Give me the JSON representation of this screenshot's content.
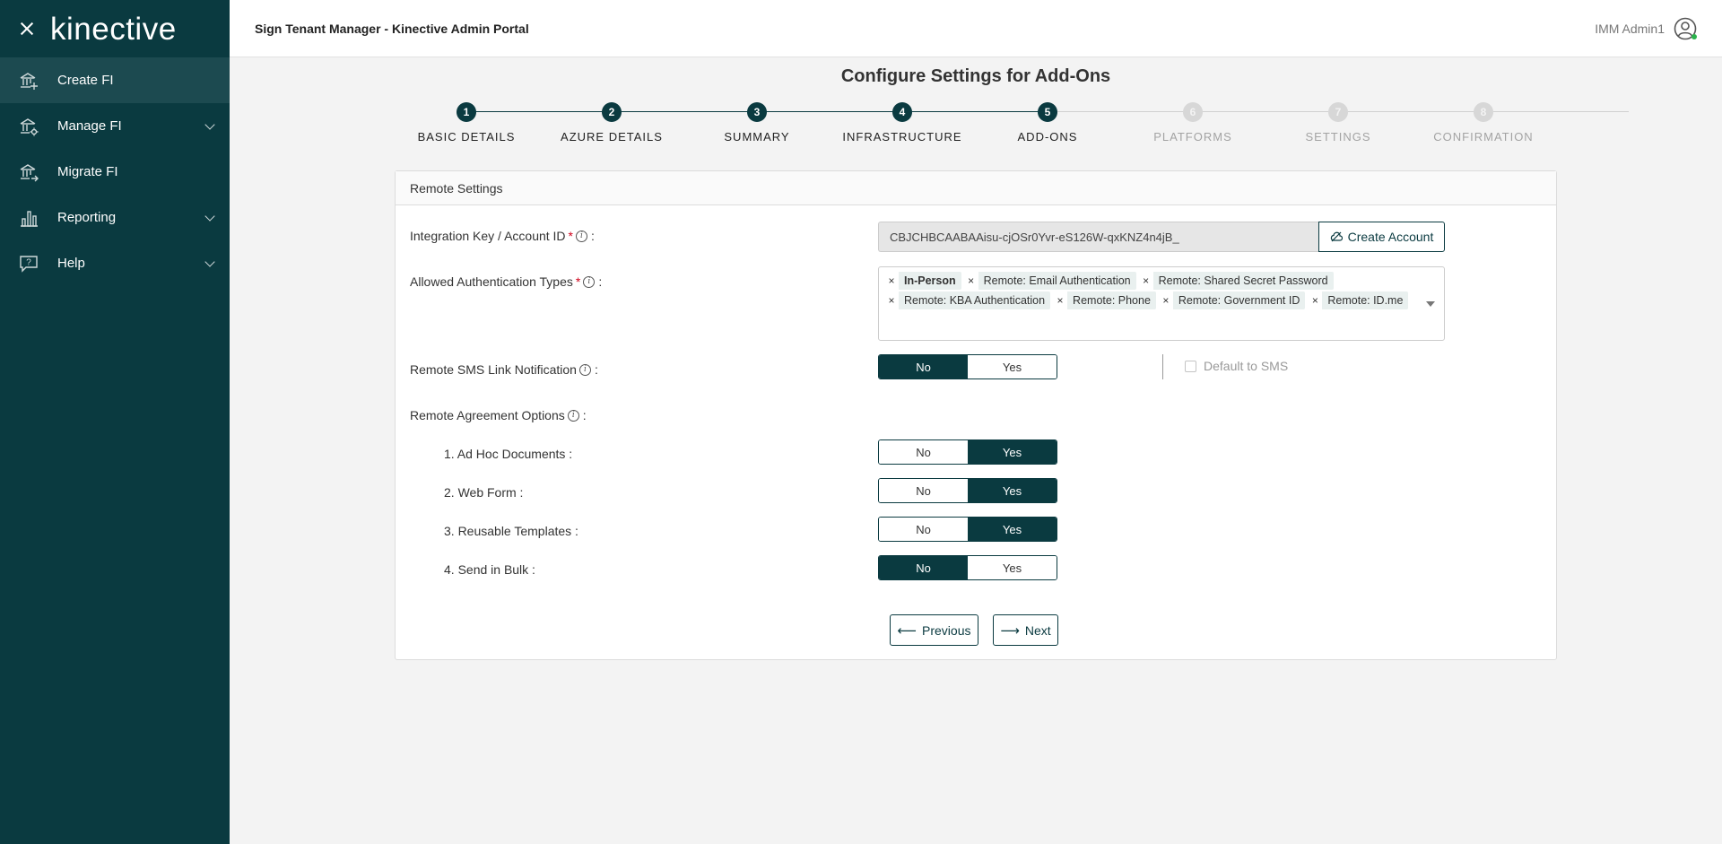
{
  "sidebar": {
    "logo": "kinective",
    "items": [
      {
        "label": "Create FI",
        "icon": "bank-plus-icon",
        "active": true,
        "has_chevron": false
      },
      {
        "label": "Manage FI",
        "icon": "bank-gear-icon",
        "active": false,
        "has_chevron": true
      },
      {
        "label": "Migrate FI",
        "icon": "bank-arrow-icon",
        "active": false,
        "has_chevron": false
      },
      {
        "label": "Reporting",
        "icon": "bar-chart-icon",
        "active": false,
        "has_chevron": true
      },
      {
        "label": "Help",
        "icon": "help-bubble-icon",
        "active": false,
        "has_chevron": true
      }
    ]
  },
  "topbar": {
    "title": "Sign Tenant Manager - Kinective Admin Portal",
    "user": "IMM Admin1"
  },
  "page": {
    "title": "Configure Settings for Add-Ons"
  },
  "stepper": {
    "steps": [
      {
        "number": "1",
        "label": "Basic Details",
        "state": "done"
      },
      {
        "number": "2",
        "label": "Azure Details",
        "state": "done"
      },
      {
        "number": "3",
        "label": "Summary",
        "state": "done"
      },
      {
        "number": "4",
        "label": "Infrastructure",
        "state": "done"
      },
      {
        "number": "5",
        "label": "Add-Ons",
        "state": "current"
      },
      {
        "number": "6",
        "label": "Platforms",
        "state": "pending"
      },
      {
        "number": "7",
        "label": "Settings",
        "state": "pending"
      },
      {
        "number": "8",
        "label": "Confirmation",
        "state": "pending"
      }
    ]
  },
  "card": {
    "title": "Remote Settings",
    "integration_key": {
      "label": "Integration Key / Account ID",
      "value": "CBJCHBCAABAAisu-cjOSr0Yvr-eS126W-qxKNZ4n4jB_",
      "button": "Create Account"
    },
    "auth_types": {
      "label": "Allowed Authentication Types",
      "chips": [
        {
          "label": "In-Person",
          "bold": true
        },
        {
          "label": "Remote: Email Authentication",
          "bold": false
        },
        {
          "label": "Remote: Shared Secret Password",
          "bold": false
        },
        {
          "label": "Remote: KBA Authentication",
          "bold": false
        },
        {
          "label": "Remote: Phone",
          "bold": false
        },
        {
          "label": "Remote: Government ID",
          "bold": false
        },
        {
          "label": "Remote: ID.me",
          "bold": false
        }
      ]
    },
    "sms": {
      "label": "Remote SMS Link Notification",
      "no": "No",
      "yes": "Yes",
      "selected": "No",
      "default_label": "Default to SMS"
    },
    "agreement": {
      "label": "Remote Agreement Options",
      "options": [
        {
          "label": "1. Ad Hoc Documents :",
          "selected": "Yes"
        },
        {
          "label": "2. Web Form :",
          "selected": "Yes"
        },
        {
          "label": "3. Reusable Templates :",
          "selected": "Yes"
        },
        {
          "label": "4. Send in Bulk :",
          "selected": "No"
        }
      ],
      "no": "No",
      "yes": "Yes"
    },
    "buttons": {
      "previous": "Previous",
      "next": "Next"
    }
  },
  "colors": {
    "brand": "#0a3a40",
    "required": "#d0021b",
    "chip_bg": "#e9f0ef"
  }
}
